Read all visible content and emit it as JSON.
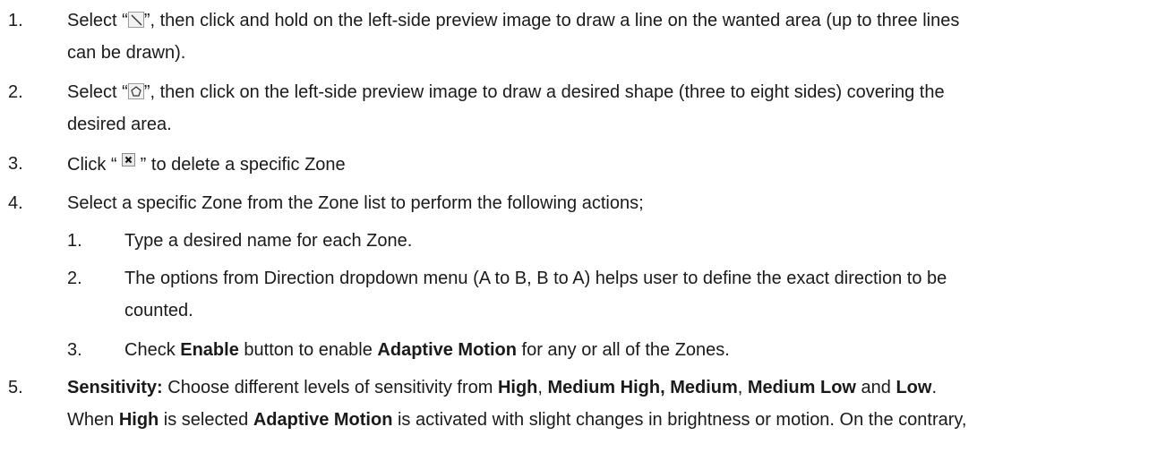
{
  "items": [
    {
      "number": "1.",
      "pre": "Select “",
      "icon": "draw-line-icon",
      "post": "”, then click and hold on the left-side preview image to draw a line on the wanted area (up to three lines",
      "cont": "can be drawn)."
    },
    {
      "number": "2.",
      "pre": "Select “",
      "icon": "draw-polygon-icon",
      "post": "”, then click on the left-side preview image to draw a desired shape (three to eight sides) covering the",
      "cont": "desired area."
    },
    {
      "number": "3.",
      "pre": "Click “ ",
      "icon": "delete-zone-icon",
      "post": " ” to delete a specific Zone"
    },
    {
      "number": "4.",
      "text": "Select a specific Zone from the Zone list to perform the following actions;",
      "sub": [
        {
          "number": "1.",
          "text": "Type a desired name for each Zone."
        },
        {
          "number": "2.",
          "text": "The options from Direction dropdown menu (A to B, B to A) helps user to define the exact direction to be",
          "cont": "counted."
        },
        {
          "number": "3.",
          "pre": "Check ",
          "bold1": "Enable",
          "mid": " button to enable ",
          "bold2": "Adaptive Motion",
          "post": " for any or all of the Zones."
        }
      ]
    },
    {
      "number": "5.",
      "line1": {
        "b_label": "Sensitivity:",
        "t1": " Choose different levels of sensitivity from ",
        "b_high": "High",
        "t2": ", ",
        "b_medhigh": "Medium High,",
        "t3": " ",
        "b_medium": "Medium",
        "t4": ", ",
        "b_medlow": "Medium Low",
        "t5": " and ",
        "b_low": "Low",
        "t6": "."
      },
      "line2": {
        "t1": "When ",
        "b_high": "High",
        "t2": " is selected ",
        "b_am": "Adaptive Motion",
        "t3": " is activated with slight changes in brightness or motion. On the contrary,"
      }
    }
  ]
}
